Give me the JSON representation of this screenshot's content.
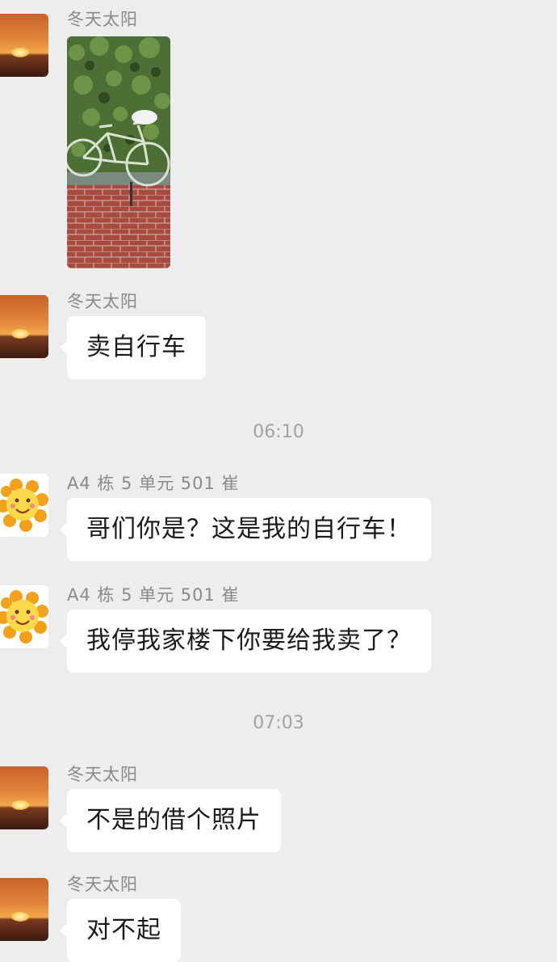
{
  "messages": [
    {
      "sender": "冬天太阳",
      "type": "image",
      "alt_icon": "bicycle-photo"
    },
    {
      "sender": "冬天太阳",
      "type": "text",
      "text": "卖自行车"
    },
    {
      "sender": "A4 栋 5 单元 501 崔",
      "type": "text",
      "text": "哥们你是？这是我的自行车！"
    },
    {
      "sender": "A4 栋 5 单元 501 崔",
      "type": "text",
      "text": "我停我家楼下你要给我卖了？"
    },
    {
      "sender": "冬天太阳",
      "type": "text",
      "text": "不是的借个照片"
    },
    {
      "sender": "冬天太阳",
      "type": "text",
      "text": "对不起"
    }
  ],
  "timestamps": [
    "06:10",
    "07:03"
  ],
  "colors": {
    "background": "#ededed",
    "bubble": "#ffffff",
    "sender_text": "#8a8a8a",
    "timestamp_text": "#a3a3a3"
  }
}
